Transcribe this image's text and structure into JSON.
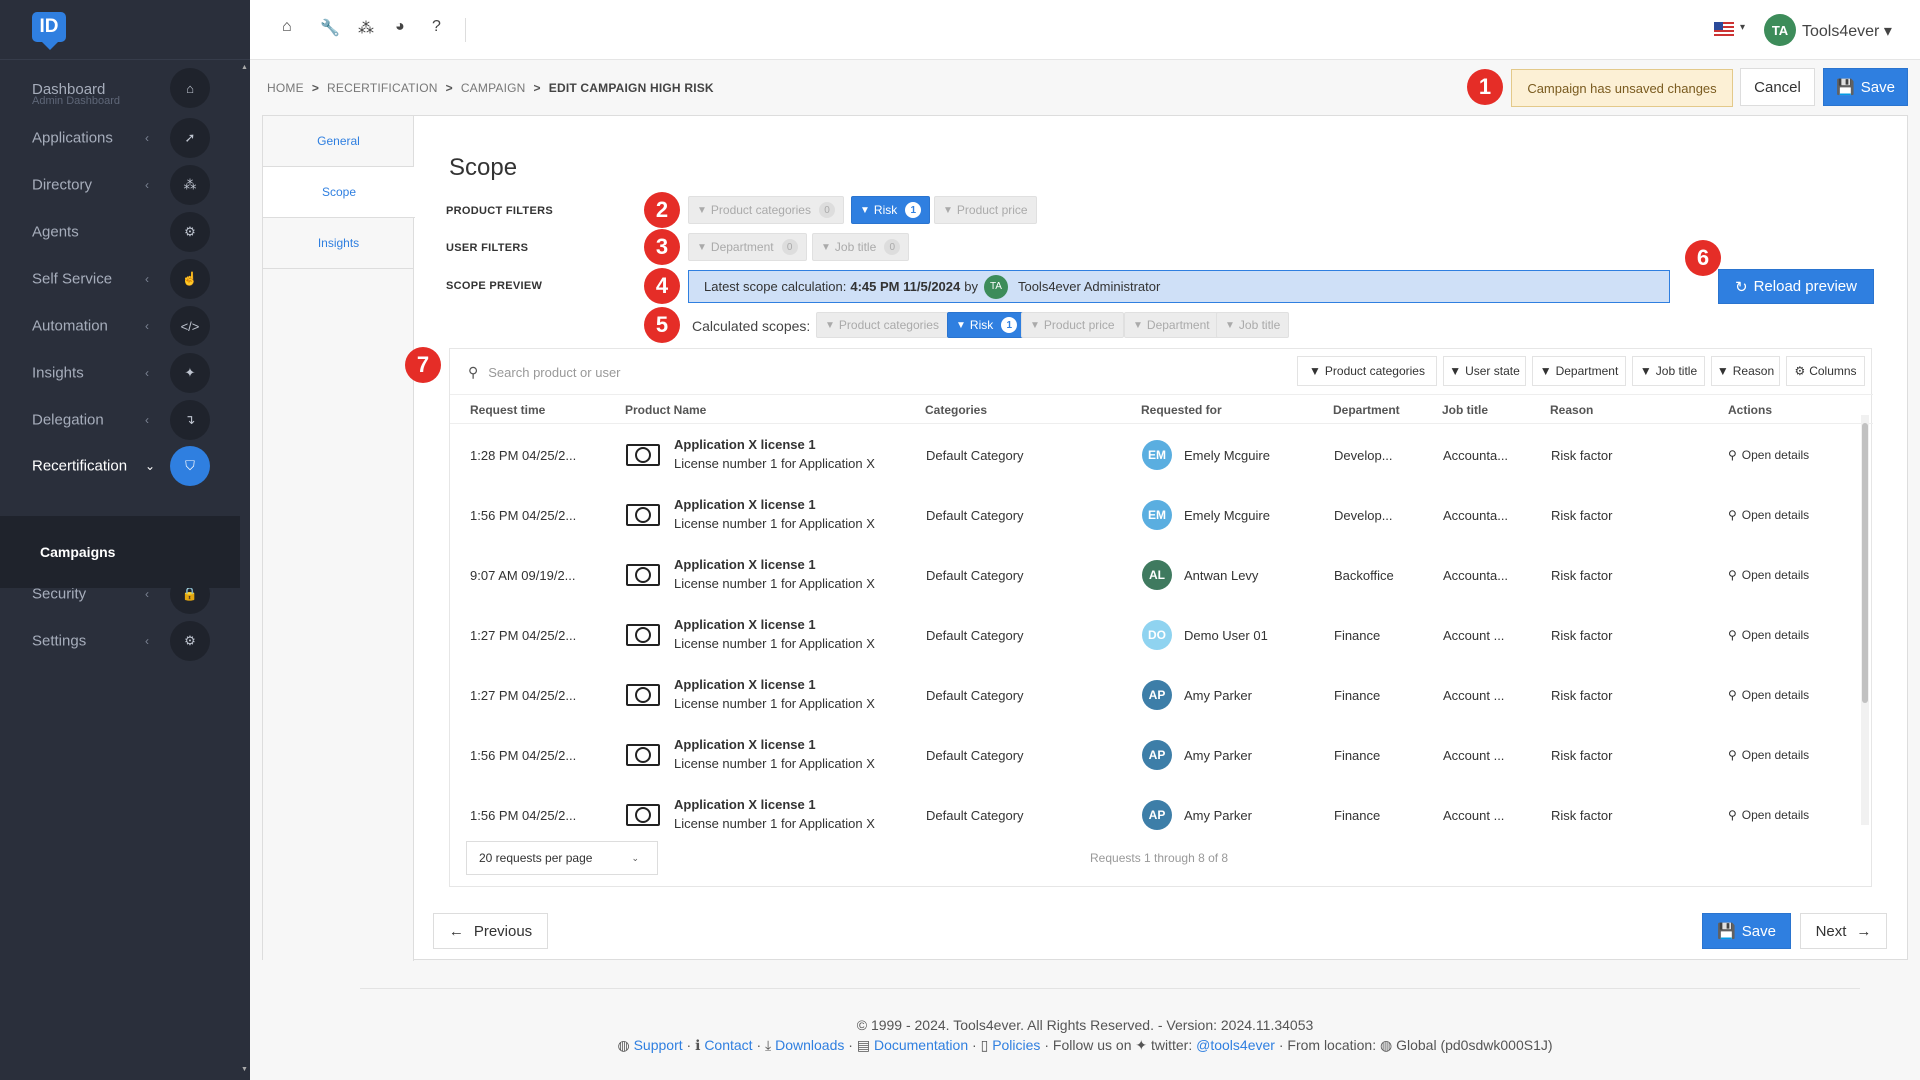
{
  "sidebar": {
    "logo": "ID",
    "items": [
      {
        "label": "Dashboard",
        "sub": "Admin Dashboard",
        "icon": "⌂",
        "chevron": ""
      },
      {
        "label": "Applications",
        "icon": "➚",
        "chevron": "‹"
      },
      {
        "label": "Directory",
        "icon": "⁂",
        "chevron": "‹"
      },
      {
        "label": "Agents",
        "icon": "⚙",
        "chevron": ""
      },
      {
        "label": "Self Service",
        "icon": "☝",
        "chevron": "‹"
      },
      {
        "label": "Automation",
        "icon": "</>",
        "chevron": "‹"
      },
      {
        "label": "Insights",
        "icon": "✦",
        "chevron": "‹"
      },
      {
        "label": "Delegation",
        "icon": "↴",
        "chevron": "‹"
      },
      {
        "label": "Recertification",
        "icon": "⛉",
        "chevron": "⌄"
      },
      {
        "label": "Security",
        "icon": "🔒",
        "chevron": "‹"
      },
      {
        "label": "Settings",
        "icon": "⚙",
        "chevron": "‹"
      }
    ],
    "subitem": "Campaigns"
  },
  "topbar": {
    "user_initials": "TA",
    "user_name": "Tools4ever ▾",
    "flag_caret": "▾"
  },
  "breadcrumb": {
    "items": [
      "HOME",
      "RECERTIFICATION",
      "CAMPAIGN"
    ],
    "current": "EDIT CAMPAIGN HIGH RISK",
    "separator": ">"
  },
  "markers": [
    "1",
    "2",
    "3",
    "4",
    "5",
    "6",
    "7"
  ],
  "header": {
    "unsaved": "Campaign has unsaved changes",
    "cancel": "Cancel",
    "save": "Save"
  },
  "tabs": [
    "General",
    "Scope",
    "Insights"
  ],
  "scope": {
    "title": "Scope",
    "product_filters_label": "PRODUCT FILTERS",
    "user_filters_label": "USER FILTERS",
    "scope_preview_label": "SCOPE PREVIEW",
    "product_filters": [
      {
        "label": "Product categories",
        "count": "0",
        "on": false
      },
      {
        "label": "Risk",
        "count": "1",
        "on": true
      },
      {
        "label": "Product price",
        "count": "",
        "on": false
      }
    ],
    "user_filters": [
      {
        "label": "Department",
        "count": "0"
      },
      {
        "label": "Job title",
        "count": "0"
      }
    ],
    "preview_prefix": "Latest scope calculation:",
    "preview_time": "4:45 PM 11/5/2024",
    "preview_by": "by",
    "preview_initials": "TA",
    "preview_user": "Tools4ever Administrator",
    "reload": "Reload preview",
    "calculated_label": "Calculated scopes:",
    "calculated": [
      {
        "label": "Product categories",
        "count": "",
        "on": false
      },
      {
        "label": "Risk",
        "count": "1",
        "on": true
      },
      {
        "label": "Product price",
        "count": "",
        "on": false
      },
      {
        "label": "Department",
        "count": "",
        "on": false
      },
      {
        "label": "Job title",
        "count": "",
        "on": false
      }
    ]
  },
  "table": {
    "search_placeholder": "Search product or user",
    "toolbar": [
      "Product categories",
      "User state",
      "Department",
      "Job title",
      "Reason",
      "Columns"
    ],
    "columns": [
      "Request time",
      "Product Name",
      "Categories",
      "Requested for",
      "Department",
      "Job title",
      "Reason",
      "Actions"
    ],
    "rows": [
      {
        "time": "1:28 PM 04/25/2...",
        "product": "Application X license 1",
        "sub": "License number 1 for Application X",
        "category": "Default Category",
        "initials": "EM",
        "color": "#5aaee0",
        "user": "Emely Mcguire",
        "dept": "Develop...",
        "job": "Accounta...",
        "reason": "Risk factor",
        "action": "Open details"
      },
      {
        "time": "1:56 PM 04/25/2...",
        "product": "Application X license 1",
        "sub": "License number 1 for Application X",
        "category": "Default Category",
        "initials": "EM",
        "color": "#5aaee0",
        "user": "Emely Mcguire",
        "dept": "Develop...",
        "job": "Accounta...",
        "reason": "Risk factor",
        "action": "Open details"
      },
      {
        "time": "9:07 AM 09/19/2...",
        "product": "Application X license 1",
        "sub": "License number 1 for Application X",
        "category": "Default Category",
        "initials": "AL",
        "color": "#3f7a5f",
        "user": "Antwan Levy",
        "dept": "Backoffice",
        "job": "Accounta...",
        "reason": "Risk factor",
        "action": "Open details"
      },
      {
        "time": "1:27 PM 04/25/2...",
        "product": "Application X license 1",
        "sub": "License number 1 for Application X",
        "category": "Default Category",
        "initials": "DO",
        "color": "#8fd3f0",
        "user": "Demo User 01",
        "dept": "Finance",
        "job": "Account ...",
        "reason": "Risk factor",
        "action": "Open details"
      },
      {
        "time": "1:27 PM 04/25/2...",
        "product": "Application X license 1",
        "sub": "License number 1 for Application X",
        "category": "Default Category",
        "initials": "AP",
        "color": "#3d7ea8",
        "user": "Amy Parker",
        "dept": "Finance",
        "job": "Account ...",
        "reason": "Risk factor",
        "action": "Open details"
      },
      {
        "time": "1:56 PM 04/25/2...",
        "product": "Application X license 1",
        "sub": "License number 1 for Application X",
        "category": "Default Category",
        "initials": "AP",
        "color": "#3d7ea8",
        "user": "Amy Parker",
        "dept": "Finance",
        "job": "Account ...",
        "reason": "Risk factor",
        "action": "Open details"
      },
      {
        "time": "1:56 PM 04/25/2...",
        "product": "Application X license 1",
        "sub": "License number 1 for Application X",
        "category": "Default Category",
        "initials": "AP",
        "color": "#3d7ea8",
        "user": "Amy Parker",
        "dept": "Finance",
        "job": "Account ...",
        "reason": "Risk factor",
        "action": "Open details"
      }
    ],
    "per_page": "20 requests per page",
    "paging_info": "Requests 1 through 8 of 8"
  },
  "nav": {
    "previous": "Previous",
    "save": "Save",
    "next": "Next"
  },
  "footer": {
    "copyright": "© 1999 - 2024. Tools4ever. All Rights Reserved. - Version: 2024.11.34053",
    "support": "Support",
    "contact": "Contact",
    "downloads": "Downloads",
    "documentation": "Documentation",
    "policies": "Policies",
    "follow": "Follow us on",
    "twitter_label": "twitter:",
    "twitter_handle": "@tools4ever",
    "location_label": "From location:",
    "location": "Global (pd0sdwk000S1J)"
  }
}
